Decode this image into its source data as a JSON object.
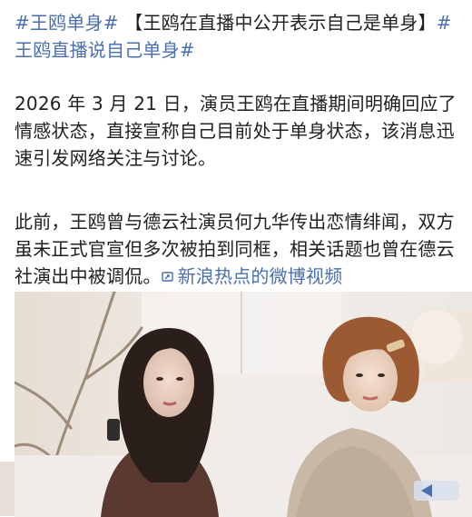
{
  "post": {
    "title": {
      "tag_1": "#王鸥单身#",
      "headline": "【王鸥在直播中公开表示自己是单身】",
      "tag_2": "#王鸥直播说自己单身#"
    },
    "paragraph_1": "2026 年 3 月 21 日，演员王鸥在直播期间明确回应了情感状态，直接宣称自己目前处于单身状态，该消息迅速引发网络关注与讨论。",
    "paragraph_2": "此前，王鸥曾与德云社演员何九华传出恋情绯闻，双方虽未正式官宣但多次被拍到同框，相关话题也曾在德云社演出中被调侃。",
    "video_link_label": "新浪热点的微博视频",
    "video_link_icon": "video-link-icon"
  },
  "colors": {
    "text": "#1f1f1f",
    "link": "#4a6fb0",
    "background": "#ffffff"
  }
}
